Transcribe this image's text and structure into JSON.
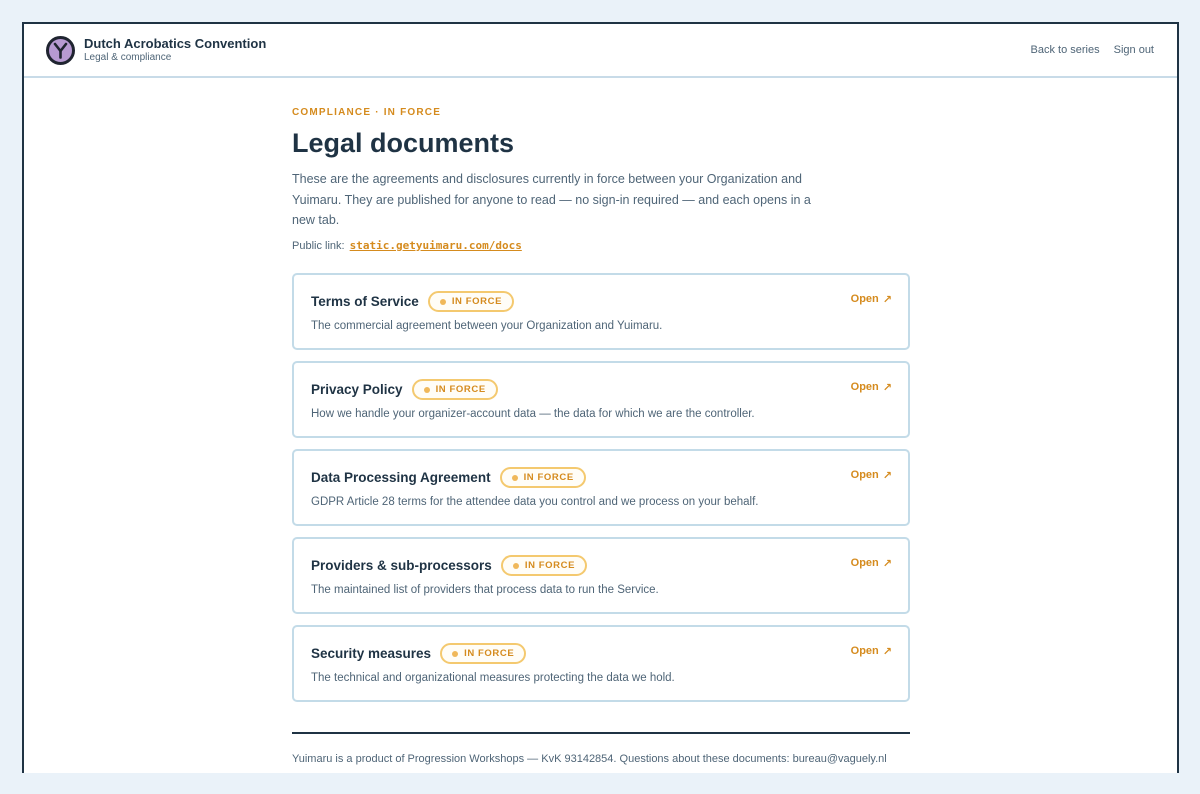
{
  "header": {
    "brand_title": "Dutch Acrobatics Convention",
    "brand_subtitle": "Legal & compliance",
    "nav": {
      "back": "Back to series",
      "sign_out": "Sign out"
    }
  },
  "main": {
    "eyebrow": "COMPLIANCE · IN FORCE",
    "title": "Legal documents",
    "intro": "These are the agreements and disclosures currently in force between your Organization and Yuimaru. They are published for anyone to read — no sign-in required — and each opens in a new tab.",
    "public_link_label": "Public link:",
    "public_link_url": "static.getyuimaru.com/docs",
    "documents": [
      {
        "title": "Terms of Service",
        "status": "IN FORCE",
        "description": "The commercial agreement between your Organization and Yuimaru.",
        "action": "Open"
      },
      {
        "title": "Privacy Policy",
        "status": "IN FORCE",
        "description": "How we handle your organizer-account data — the data for which we are the controller.",
        "action": "Open"
      },
      {
        "title": "Data Processing Agreement",
        "status": "IN FORCE",
        "description": "GDPR Article 28 terms for the attendee data you control and we process on your behalf.",
        "action": "Open"
      },
      {
        "title": "Providers & sub-processors",
        "status": "IN FORCE",
        "description": "The maintained list of providers that process data to run the Service.",
        "action": "Open"
      },
      {
        "title": "Security measures",
        "status": "IN FORCE",
        "description": "The technical and organizational measures protecting the data we hold.",
        "action": "Open"
      }
    ]
  },
  "footer": {
    "text": "Yuimaru is a product of Progression Workshops — KvK 93142854. Questions about these documents: bureau@vaguely.nl"
  },
  "icons": {
    "logo": "yuimaru-logo-icon",
    "open_arrow": "external-arrow-icon",
    "status_dot": "status-dot-icon"
  },
  "colors": {
    "accent": "#d58b1e",
    "badge_border": "#f4c96f",
    "card_border": "#c3dbe8",
    "text_dark": "#1f3344",
    "text_muted": "#4f6577",
    "page_bg": "#eaf2f9"
  }
}
